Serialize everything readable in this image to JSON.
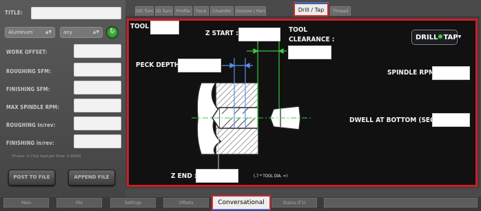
{
  "left_panel": {
    "title_label": "TITLE:",
    "material_value": "Aluminum",
    "material_option": "any",
    "fields": [
      {
        "label": "WORK OFFSET:"
      },
      {
        "label": "ROUGHING SFM:"
      },
      {
        "label": "FINISHING SFM:"
      },
      {
        "label": "MAX SPINDLE RPM:"
      },
      {
        "label": "ROUGHING in/rev:"
      },
      {
        "label": "FINISHING in/rev:"
      }
    ],
    "note": "(Flutes: 4    Chip load per flute: 0.0000)",
    "post_button": "POST TO FILE",
    "append_button": "APPEND FILE"
  },
  "top_tabs": [
    "OD Turn",
    "ID Turn",
    "Profile",
    "Face",
    "Chamfer",
    "Groove / Part",
    "Drill / Tap",
    "Thread"
  ],
  "active_top_tab": "Drill / Tap",
  "drill_form": {
    "tool_label": "TOOL :",
    "z_start_label": "Z START :",
    "tool_clearance_label_1": "TOOL",
    "tool_clearance_label_2": "CLEARANCE :",
    "peck_depth_label": "PECK DEPTH :",
    "spindle_rpm_label": "SPINDLE RPM :",
    "dwell_label": "DWELL AT BOTTOM (SEC) :",
    "z_end_label": "Z END :",
    "z_end_note": "(.7 * TOOL DIA. =)",
    "mode_button": {
      "left": "DRILL",
      "right": "TAP"
    }
  },
  "bottom_tabs": [
    "Main",
    "File",
    "Settings",
    "Offsets",
    "Conversational",
    "Status (F1)"
  ],
  "active_bottom_tab": "Conversational",
  "colors": {
    "accent_red": "#d01c24",
    "tab_blue": "#5566cc",
    "indicator_green": "#3ed03e"
  }
}
